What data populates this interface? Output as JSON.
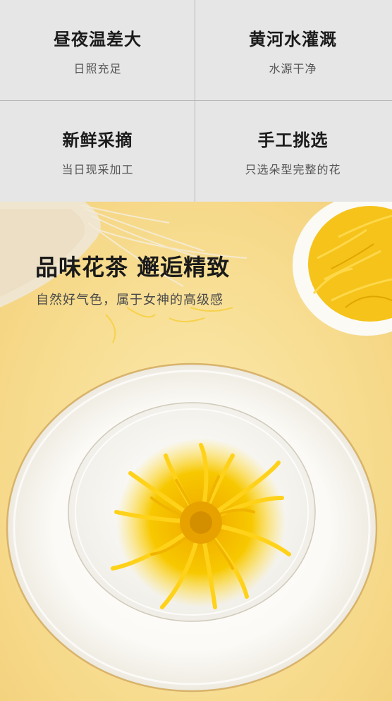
{
  "features": [
    {
      "title": "昼夜温差大",
      "subtitle": "日照充足"
    },
    {
      "title": "黄河水灌溉",
      "subtitle": "水源干净"
    },
    {
      "title": "新鲜采摘",
      "subtitle": "当日现采加工"
    },
    {
      "title": "手工挑选",
      "subtitle": "只选朵型完整的花"
    }
  ],
  "hero": {
    "headline": "品味花茶 邂逅精致",
    "subline": "自然好气色，属于女神的高级感"
  },
  "colors": {
    "grid_bg": "#e6e6e6",
    "background_yellow": "#f7dc8f",
    "flower_yellow": "#f5c400",
    "plate_rim_gold": "#d8b36a"
  }
}
